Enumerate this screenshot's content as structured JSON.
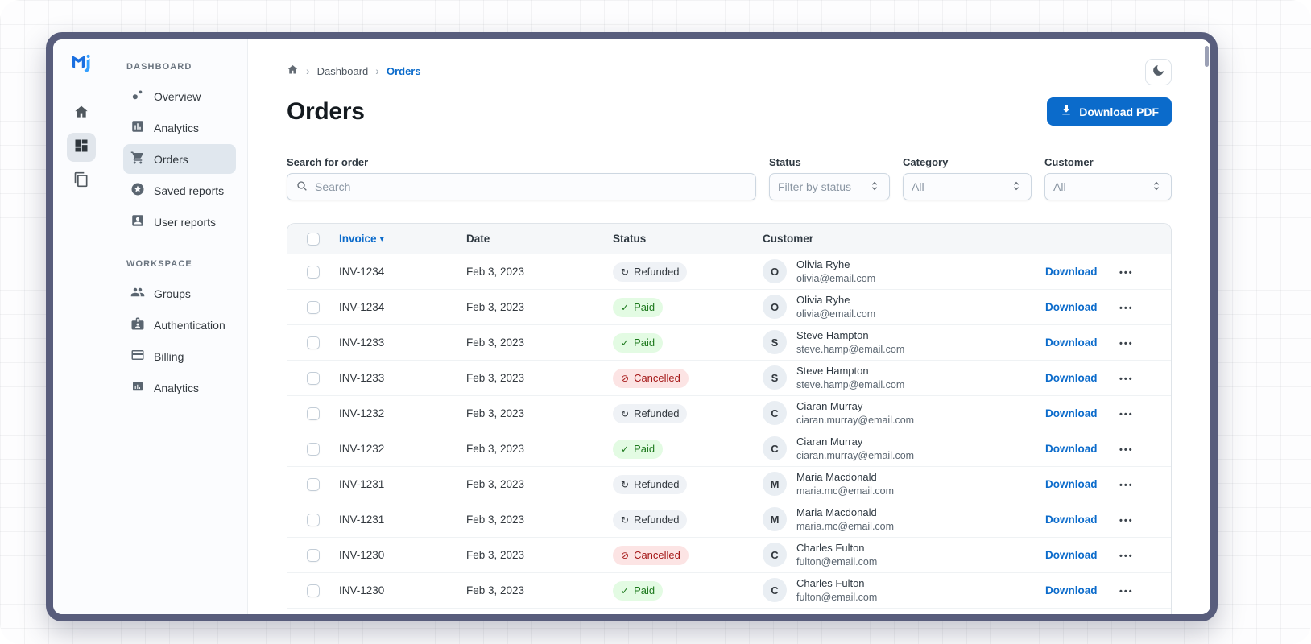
{
  "rail": {
    "logo_icon": "mui-logo",
    "items": [
      {
        "icon": "home-icon",
        "selected": false
      },
      {
        "icon": "dashboard-grid-icon",
        "selected": true
      },
      {
        "icon": "stacked-pages-icon",
        "selected": false
      }
    ]
  },
  "sidebar": {
    "sections": [
      {
        "label": "DASHBOARD",
        "items": [
          {
            "label": "Overview",
            "icon": "scatter-dots-icon",
            "selected": false
          },
          {
            "label": "Analytics",
            "icon": "bar-chart-icon",
            "selected": false
          },
          {
            "label": "Orders",
            "icon": "shopping-cart-icon",
            "selected": true
          },
          {
            "label": "Saved reports",
            "icon": "star-circle-icon",
            "selected": false
          },
          {
            "label": "User reports",
            "icon": "person-box-icon",
            "selected": false
          }
        ]
      },
      {
        "label": "WORKSPACE",
        "items": [
          {
            "label": "Groups",
            "icon": "people-icon",
            "selected": false
          },
          {
            "label": "Authentication",
            "icon": "id-badge-icon",
            "selected": false
          },
          {
            "label": "Billing",
            "icon": "credit-card-icon",
            "selected": false
          },
          {
            "label": "Analytics",
            "icon": "chart-box-icon",
            "selected": false
          }
        ]
      }
    ]
  },
  "breadcrumb": {
    "home_icon": "home-icon",
    "separator": "›",
    "items": [
      "Dashboard",
      "Orders"
    ]
  },
  "page": {
    "title": "Orders"
  },
  "toolbar": {
    "download_pdf_label": "Download PDF",
    "download_icon": "download-icon",
    "theme_icon": "moon-icon"
  },
  "filters": {
    "search": {
      "label": "Search for order",
      "placeholder": "Search",
      "icon": "search-icon"
    },
    "status": {
      "label": "Status",
      "value": "Filter by status"
    },
    "category": {
      "label": "Category",
      "value": "All"
    },
    "customer": {
      "label": "Customer",
      "value": "All"
    }
  },
  "glyphs": {
    "sort_desc": "▾",
    "check": "✓",
    "refresh": "↻",
    "block": "⊘",
    "menu_dots": "•••"
  },
  "table": {
    "columns": [
      "Invoice",
      "Date",
      "Status",
      "Customer"
    ],
    "sort": {
      "column": "Invoice",
      "direction": "desc"
    },
    "action_label": "Download",
    "partial_row_visible": true,
    "rows": [
      {
        "invoice": "INV-1234",
        "date": "Feb 3, 2023",
        "status": "Refunded",
        "customer": {
          "initial": "O",
          "name": "Olivia Ryhe",
          "email": "olivia@email.com"
        }
      },
      {
        "invoice": "INV-1234",
        "date": "Feb 3, 2023",
        "status": "Paid",
        "customer": {
          "initial": "O",
          "name": "Olivia Ryhe",
          "email": "olivia@email.com"
        }
      },
      {
        "invoice": "INV-1233",
        "date": "Feb 3, 2023",
        "status": "Paid",
        "customer": {
          "initial": "S",
          "name": "Steve Hampton",
          "email": "steve.hamp@email.com"
        }
      },
      {
        "invoice": "INV-1233",
        "date": "Feb 3, 2023",
        "status": "Cancelled",
        "customer": {
          "initial": "S",
          "name": "Steve Hampton",
          "email": "steve.hamp@email.com"
        }
      },
      {
        "invoice": "INV-1232",
        "date": "Feb 3, 2023",
        "status": "Refunded",
        "customer": {
          "initial": "C",
          "name": "Ciaran Murray",
          "email": "ciaran.murray@email.com"
        }
      },
      {
        "invoice": "INV-1232",
        "date": "Feb 3, 2023",
        "status": "Paid",
        "customer": {
          "initial": "C",
          "name": "Ciaran Murray",
          "email": "ciaran.murray@email.com"
        }
      },
      {
        "invoice": "INV-1231",
        "date": "Feb 3, 2023",
        "status": "Refunded",
        "customer": {
          "initial": "M",
          "name": "Maria Macdonald",
          "email": "maria.mc@email.com"
        }
      },
      {
        "invoice": "INV-1231",
        "date": "Feb 3, 2023",
        "status": "Refunded",
        "customer": {
          "initial": "M",
          "name": "Maria Macdonald",
          "email": "maria.mc@email.com"
        }
      },
      {
        "invoice": "INV-1230",
        "date": "Feb 3, 2023",
        "status": "Cancelled",
        "customer": {
          "initial": "C",
          "name": "Charles Fulton",
          "email": "fulton@email.com"
        }
      },
      {
        "invoice": "INV-1230",
        "date": "Feb 3, 2023",
        "status": "Paid",
        "customer": {
          "initial": "C",
          "name": "Charles Fulton",
          "email": "fulton@email.com"
        }
      }
    ]
  },
  "colors": {
    "primary": "#0B6BCB",
    "frame": "#585D7C",
    "success_bg": "#E3FBE3",
    "success_text": "#1F7A1F",
    "danger_bg": "#FCE4E4",
    "danger_text": "#A51818",
    "neutral_chip_bg": "#EFF2F6",
    "neutral_chip_text": "#32383E",
    "sidebar_bg": "#FBFCFE",
    "table_header_bg": "#F5F7F9"
  }
}
